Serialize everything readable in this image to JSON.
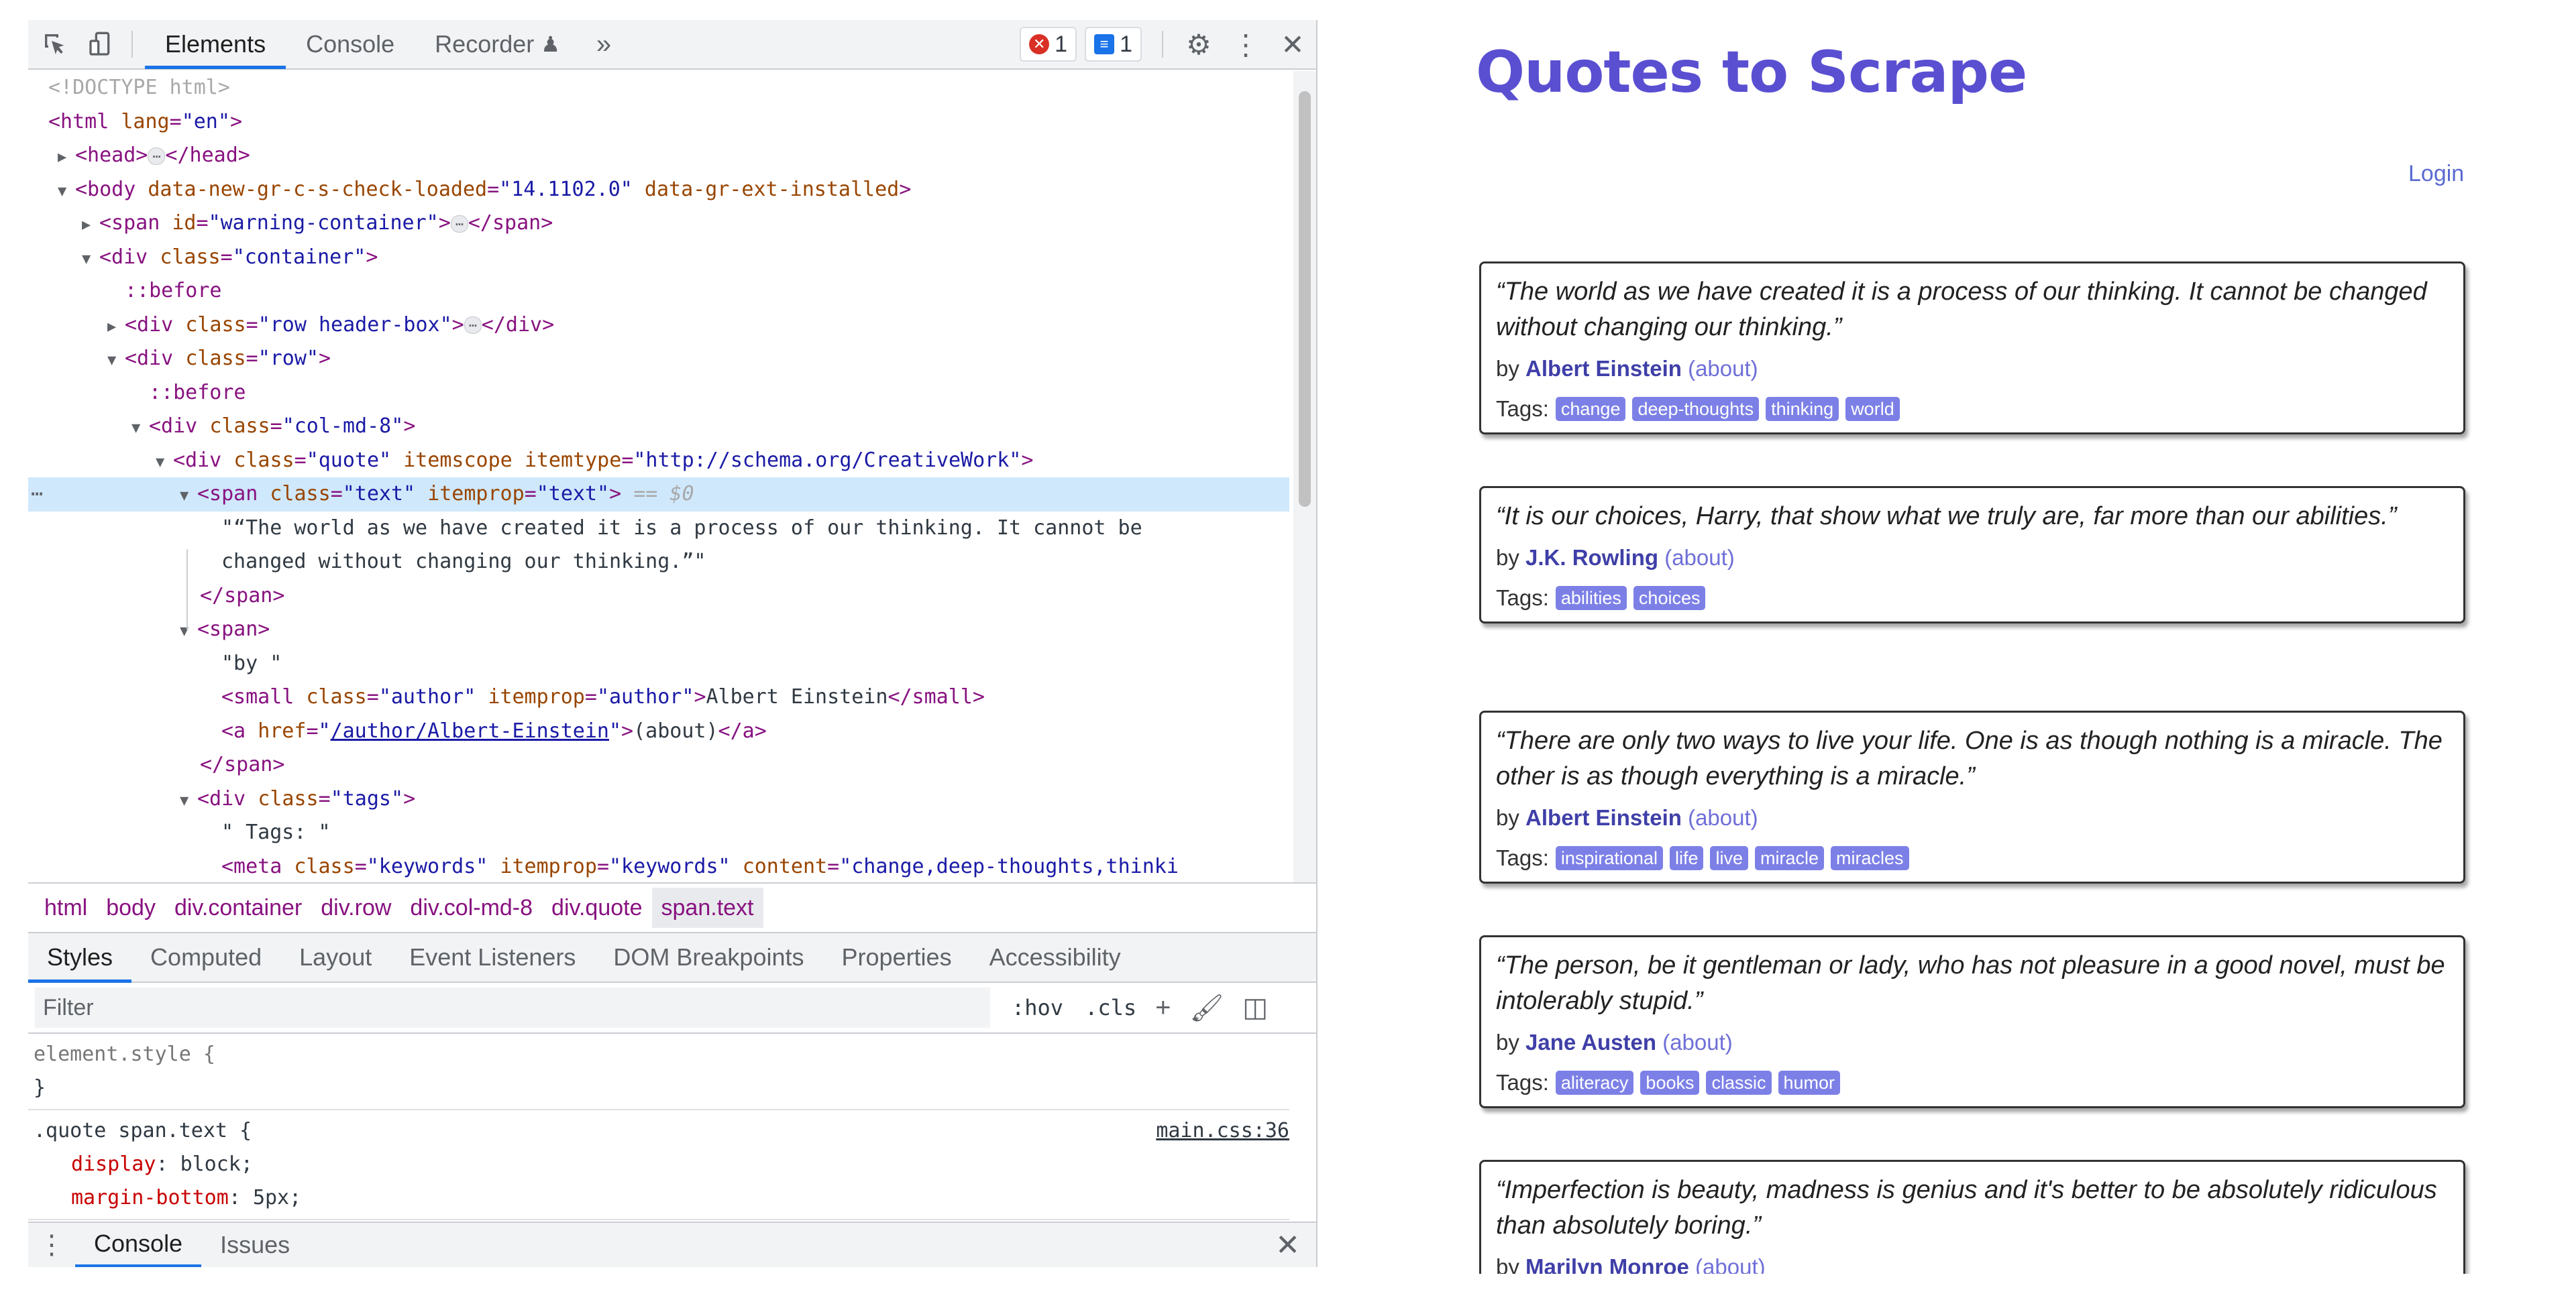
{
  "devtools": {
    "tabs": [
      "Elements",
      "Console",
      "Recorder"
    ],
    "recorder_glyph": "♟",
    "more_glyph": "»",
    "error_count": "1",
    "message_count": "1",
    "dom": {
      "doctype": "<!DOCTYPE html>",
      "html_attr": "lang",
      "html_val": "\"en\"",
      "body_attr1": "data-new-gr-c-s-check-loaded",
      "body_val1": "\"14.1102.0\"",
      "body_attr2": "data-gr-ext-installed",
      "span_warning_attr": "id",
      "span_warning_val": "\"warning-container\"",
      "container_val": "\"container\"",
      "before": "::before",
      "header_box_val": "\"row header-box\"",
      "row_val": "\"row\"",
      "colmd_val": "\"col-md-8\"",
      "quote_val": "\"quote\"",
      "itemscope": "itemscope",
      "itemtype_val": "\"http://schema.org/CreativeWork\"",
      "text_val": "\"text\"",
      "itemprop_text_val": "\"text\"",
      "selected_marker": "== $0",
      "text_line1": "\"“The world as we have created it is a process of our thinking. It cannot be",
      "text_line2": "changed without changing our thinking.”\"",
      "by_text": "\"by \"",
      "author_class_val": "\"author\"",
      "author_itemprop_val": "\"author\"",
      "author_name": "Albert Einstein",
      "href_val": "/author/Albert-Einstein",
      "about_text": "(about)",
      "tags_val": "\"tags\"",
      "tags_text": "\" Tags: \"",
      "meta_class_val": "\"keywords\"",
      "meta_itemprop_val": "\"keywords\"",
      "meta_content_val": "\"change,deep-thoughts,thinki"
    },
    "breadcrumbs": [
      "html",
      "body",
      "div.container",
      "div.row",
      "div.col-md-8",
      "div.quote",
      "span.text"
    ],
    "style_tabs": [
      "Styles",
      "Computed",
      "Layout",
      "Event Listeners",
      "DOM Breakpoints",
      "Properties",
      "Accessibility"
    ],
    "filter_placeholder": "Filter",
    "filter_hov": ":hov",
    "filter_cls": ".cls",
    "styles": {
      "element_style": "element.style {",
      "close_brace": "}",
      "selector": ".quote span.text {",
      "source": "main.css:36",
      "props": [
        {
          "name": "display",
          "value": "block;"
        },
        {
          "name": "margin-bottom",
          "value": "5px;"
        }
      ]
    },
    "drawer_tabs": [
      "Console",
      "Issues"
    ]
  },
  "site": {
    "title": "Quotes to Scrape",
    "login": "Login",
    "by_label": "by",
    "about_label": "(about)",
    "tags_label": "Tags:",
    "quotes": [
      {
        "text": "“The world as we have created it is a process of our thinking. It cannot be changed without changing our thinking.”",
        "author": "Albert Einstein",
        "tags": [
          "change",
          "deep-thoughts",
          "thinking",
          "world"
        ]
      },
      {
        "text": "“It is our choices, Harry, that show what we truly are, far more than our abilities.”",
        "author": "J.K. Rowling",
        "tags": [
          "abilities",
          "choices"
        ]
      },
      {
        "text": "“There are only two ways to live your life. One is as though nothing is a miracle. The other is as though everything is a miracle.”",
        "author": "Albert Einstein",
        "tags": [
          "inspirational",
          "life",
          "live",
          "miracle",
          "miracles"
        ]
      },
      {
        "text": "“The person, be it gentleman or lady, who has not pleasure in a good novel, must be intolerably stupid.”",
        "author": "Jane Austen",
        "tags": [
          "aliteracy",
          "books",
          "classic",
          "humor"
        ]
      },
      {
        "text": "“Imperfection is beauty, madness is genius and it's better to be absolutely ridiculous than absolutely boring.”",
        "author": "Marilyn Monroe",
        "tags": []
      }
    ]
  }
}
